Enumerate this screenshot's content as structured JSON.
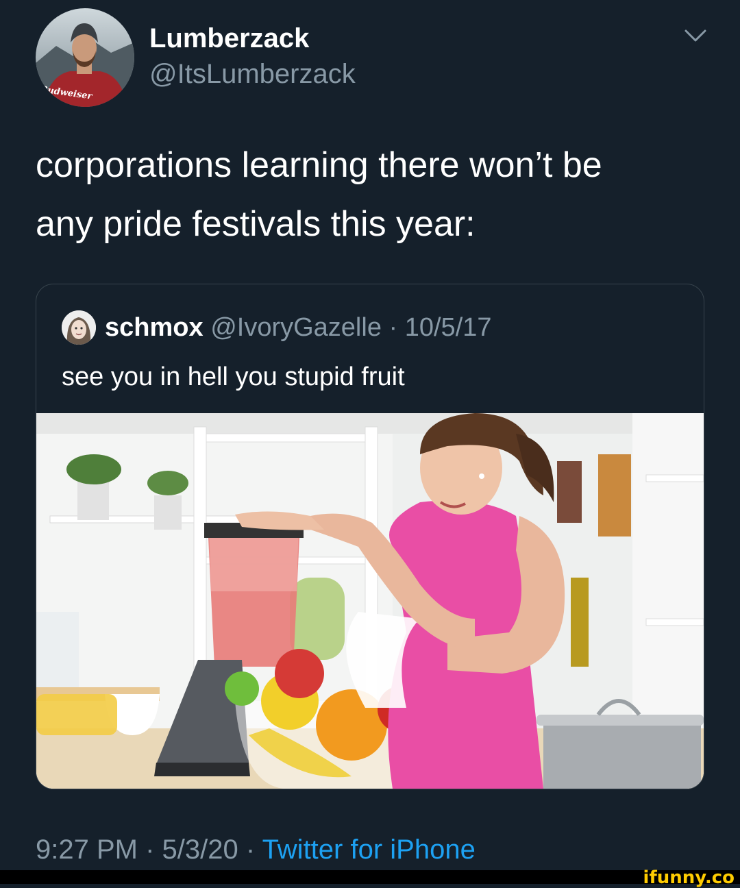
{
  "tweet": {
    "author": {
      "display_name": "Lumberzack",
      "handle": "@ItsLumberzack",
      "avatar_caption": "Budweiser"
    },
    "text_line1": "corporations learning there won’t be",
    "text_line2": "any pride festivals this year:",
    "menu_icon": "chevron-down-icon"
  },
  "quoted_tweet": {
    "author_name": "schmox",
    "handle": "@IvoryGazelle",
    "separator": " · ",
    "date": "10/5/17",
    "text": "see you in hell you stupid fruit",
    "media": "woman in pink tank top blending fruit smoothie in kitchen"
  },
  "footer": {
    "time": "9:27 PM",
    "separator1": " · ",
    "date": "5/3/20",
    "separator2": " · ",
    "source": "Twitter for iPhone"
  },
  "watermark": {
    "text": "ifunny.co"
  },
  "colors": {
    "background": "#15202b",
    "muted": "#8899a6",
    "link": "#1da1f2",
    "border": "#38444d"
  }
}
